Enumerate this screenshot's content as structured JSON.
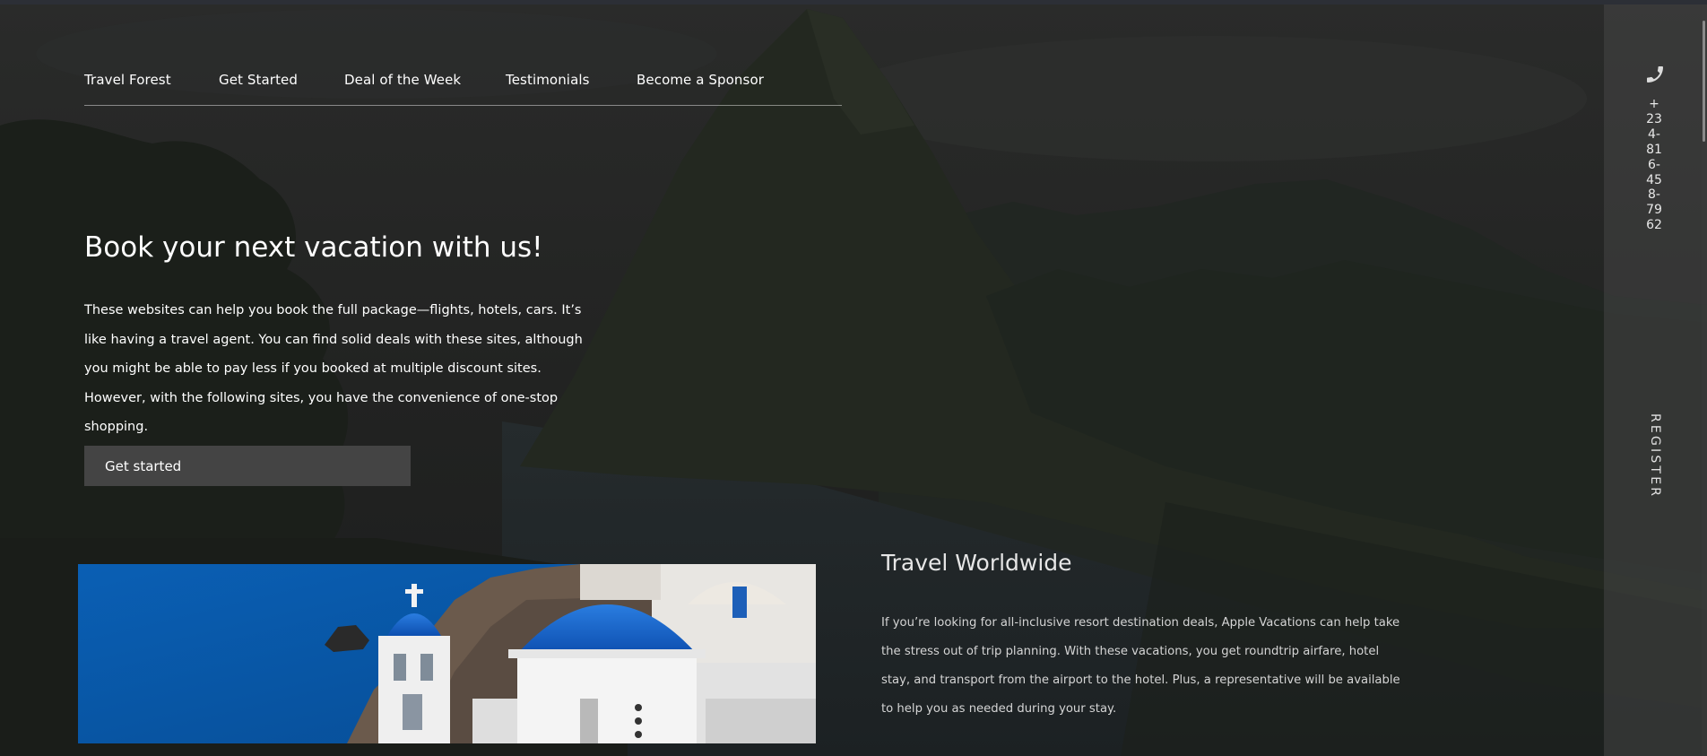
{
  "nav": {
    "items": [
      {
        "label": "Travel Forest"
      },
      {
        "label": "Get Started"
      },
      {
        "label": "Deal of the Week"
      },
      {
        "label": "Testimonials"
      },
      {
        "label": "Become a Sponsor"
      }
    ]
  },
  "hero": {
    "title": "Book your next vacation with us!",
    "text": "These websites can help you book the full package—flights, hotels, cars. It’s like having a travel agent. You can find solid deals with these sites, although you might be able to pay less if you booked at multiple discount sites. However, with the following sites, you have the convenience of one-stop shopping.",
    "button_label": "Get started"
  },
  "worldwide": {
    "title": "Travel Worldwide",
    "text": "If you’re looking for all-inclusive resort destination deals, Apple Vacations can help take the stress out of trip planning. With these vacations, you get roundtrip airfare, hotel stay, and transport from the airport to the hotel. Plus, a representative will be available to help you as needed during your stay."
  },
  "sidebar": {
    "phone_icon": "phone-icon",
    "phone": "+234-816-458-7962",
    "register_label": "REGISTER"
  },
  "colors": {
    "button_bg": "#444444",
    "sidebar_bg": "#464646",
    "dome_blue": "#1a63c8",
    "sea_blue": "#0a5fb0"
  }
}
